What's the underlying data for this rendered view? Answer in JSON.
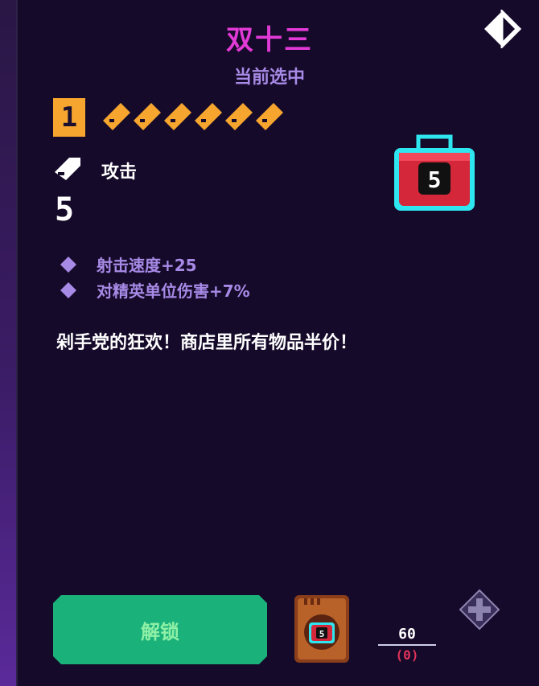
{
  "item": {
    "title": "双十三",
    "subtitle": "当前选中",
    "level": "1",
    "level_pips": 6,
    "stat_label": "攻击",
    "stat_value": "5",
    "bonuses": [
      "射击速度+25",
      "对精英单位伤害+7%"
    ],
    "description": "剁手党的狂欢！商店里所有物品半价！"
  },
  "actions": {
    "unlock_label": "解锁"
  },
  "cost": {
    "price": "60",
    "owned": "(0)"
  },
  "icons": {
    "toggle": "contrast-toggle-icon",
    "attack": "bullet-icon",
    "item": "shopping-bag-icon",
    "card": "item-card-icon",
    "dpad": "dpad-icon",
    "bonus": "diamond-icon"
  },
  "colors": {
    "title": "#e23ad6",
    "accent": "#a78ae6",
    "level": "#f6a52e",
    "button": "#1ab27a",
    "cost_owned": "#e0335a"
  }
}
